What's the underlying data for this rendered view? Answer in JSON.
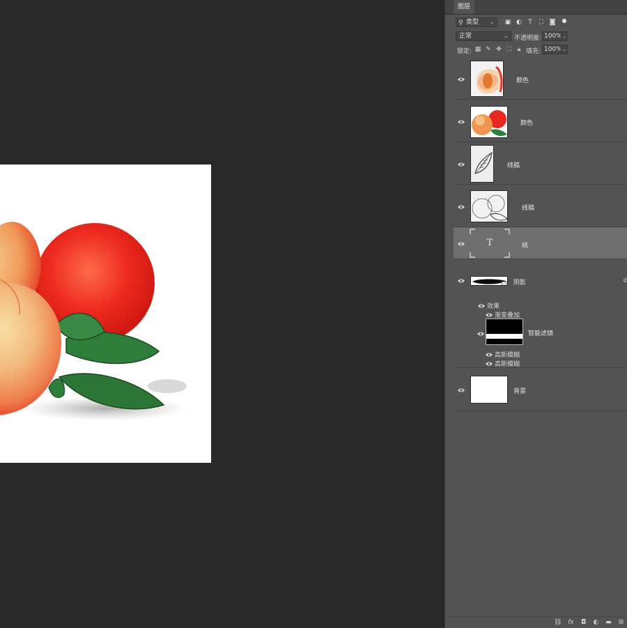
{
  "panel": {
    "tab_label": "图层",
    "filter": {
      "kind_label": "类型"
    },
    "blend_mode": "正常",
    "opacity_label": "不透明度:",
    "opacity_value": "100%",
    "lock_label": "锁定:",
    "fill_label": "填充:",
    "fill_value": "100%"
  },
  "layers": [
    {
      "name": "颜色",
      "thumb": "peach-slice"
    },
    {
      "name": "颜色",
      "thumb": "peaches-color"
    },
    {
      "name": "线稿",
      "thumb": "line-leaf"
    },
    {
      "name": "线稿",
      "thumb": "line-peach"
    },
    {
      "name": "桃",
      "thumb": "text",
      "thumb_glyph": "T",
      "selected": true
    },
    {
      "name": "阴影",
      "thumb": "shadow",
      "effects_label": "效果",
      "effect_items": [
        "渐变叠加"
      ],
      "smart_filter_label": "智能滤镜",
      "filters": [
        "高斯模糊",
        "高斯模糊"
      ]
    },
    {
      "name": "背景",
      "thumb": "white"
    }
  ],
  "colors": {
    "workspace": "#282828",
    "panel": "#535353",
    "selected_layer": "#6e6e6e",
    "peach_red": "#e8281e",
    "peach_orange": "#f19b55",
    "leaf_green": "#2e7d3a"
  }
}
